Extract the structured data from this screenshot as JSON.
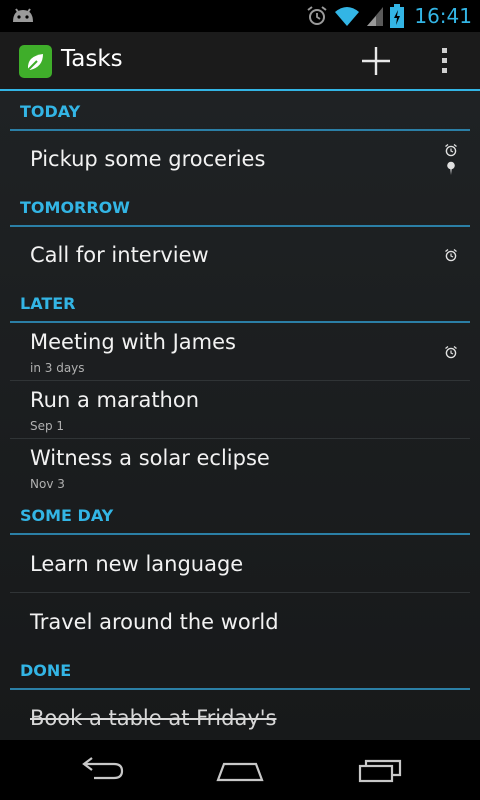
{
  "status_bar": {
    "time": "16:41",
    "icons": [
      "android-debug-icon",
      "alarm-icon",
      "wifi-icon",
      "signal-icon",
      "battery-charging-icon"
    ]
  },
  "action_bar": {
    "title": "Tasks",
    "add_label": "Add task",
    "overflow_label": "More options",
    "icon": "tasks-app-icon"
  },
  "sections": {
    "today": {
      "title": "TODAY"
    },
    "tomorrow": {
      "title": "TOMORROW"
    },
    "later": {
      "title": "LATER"
    },
    "someday": {
      "title": "SOME DAY"
    },
    "done": {
      "title": "DONE"
    }
  },
  "tasks": {
    "groceries": {
      "title": "Pickup some groceries",
      "icons": [
        "alarm-icon",
        "location-pin-icon"
      ]
    },
    "interview": {
      "title": "Call for interview",
      "icons": [
        "alarm-icon"
      ]
    },
    "meeting": {
      "title": "Meeting with James",
      "subtitle": "in 3 days",
      "icons": [
        "alarm-icon"
      ]
    },
    "marathon": {
      "title": "Run a marathon",
      "subtitle": "Sep 1"
    },
    "eclipse": {
      "title": "Witness a solar eclipse",
      "subtitle": "Nov 3"
    },
    "language": {
      "title": "Learn new language"
    },
    "travel": {
      "title": "Travel around the world"
    },
    "table": {
      "title": "Book a table at Friday's",
      "completed": true
    }
  },
  "navigation": [
    "back-icon",
    "home-icon",
    "recent-apps-icon"
  ],
  "colors": {
    "accent": "#33b5e5",
    "app_icon": "#3fae2a",
    "background": "#1f2224"
  }
}
